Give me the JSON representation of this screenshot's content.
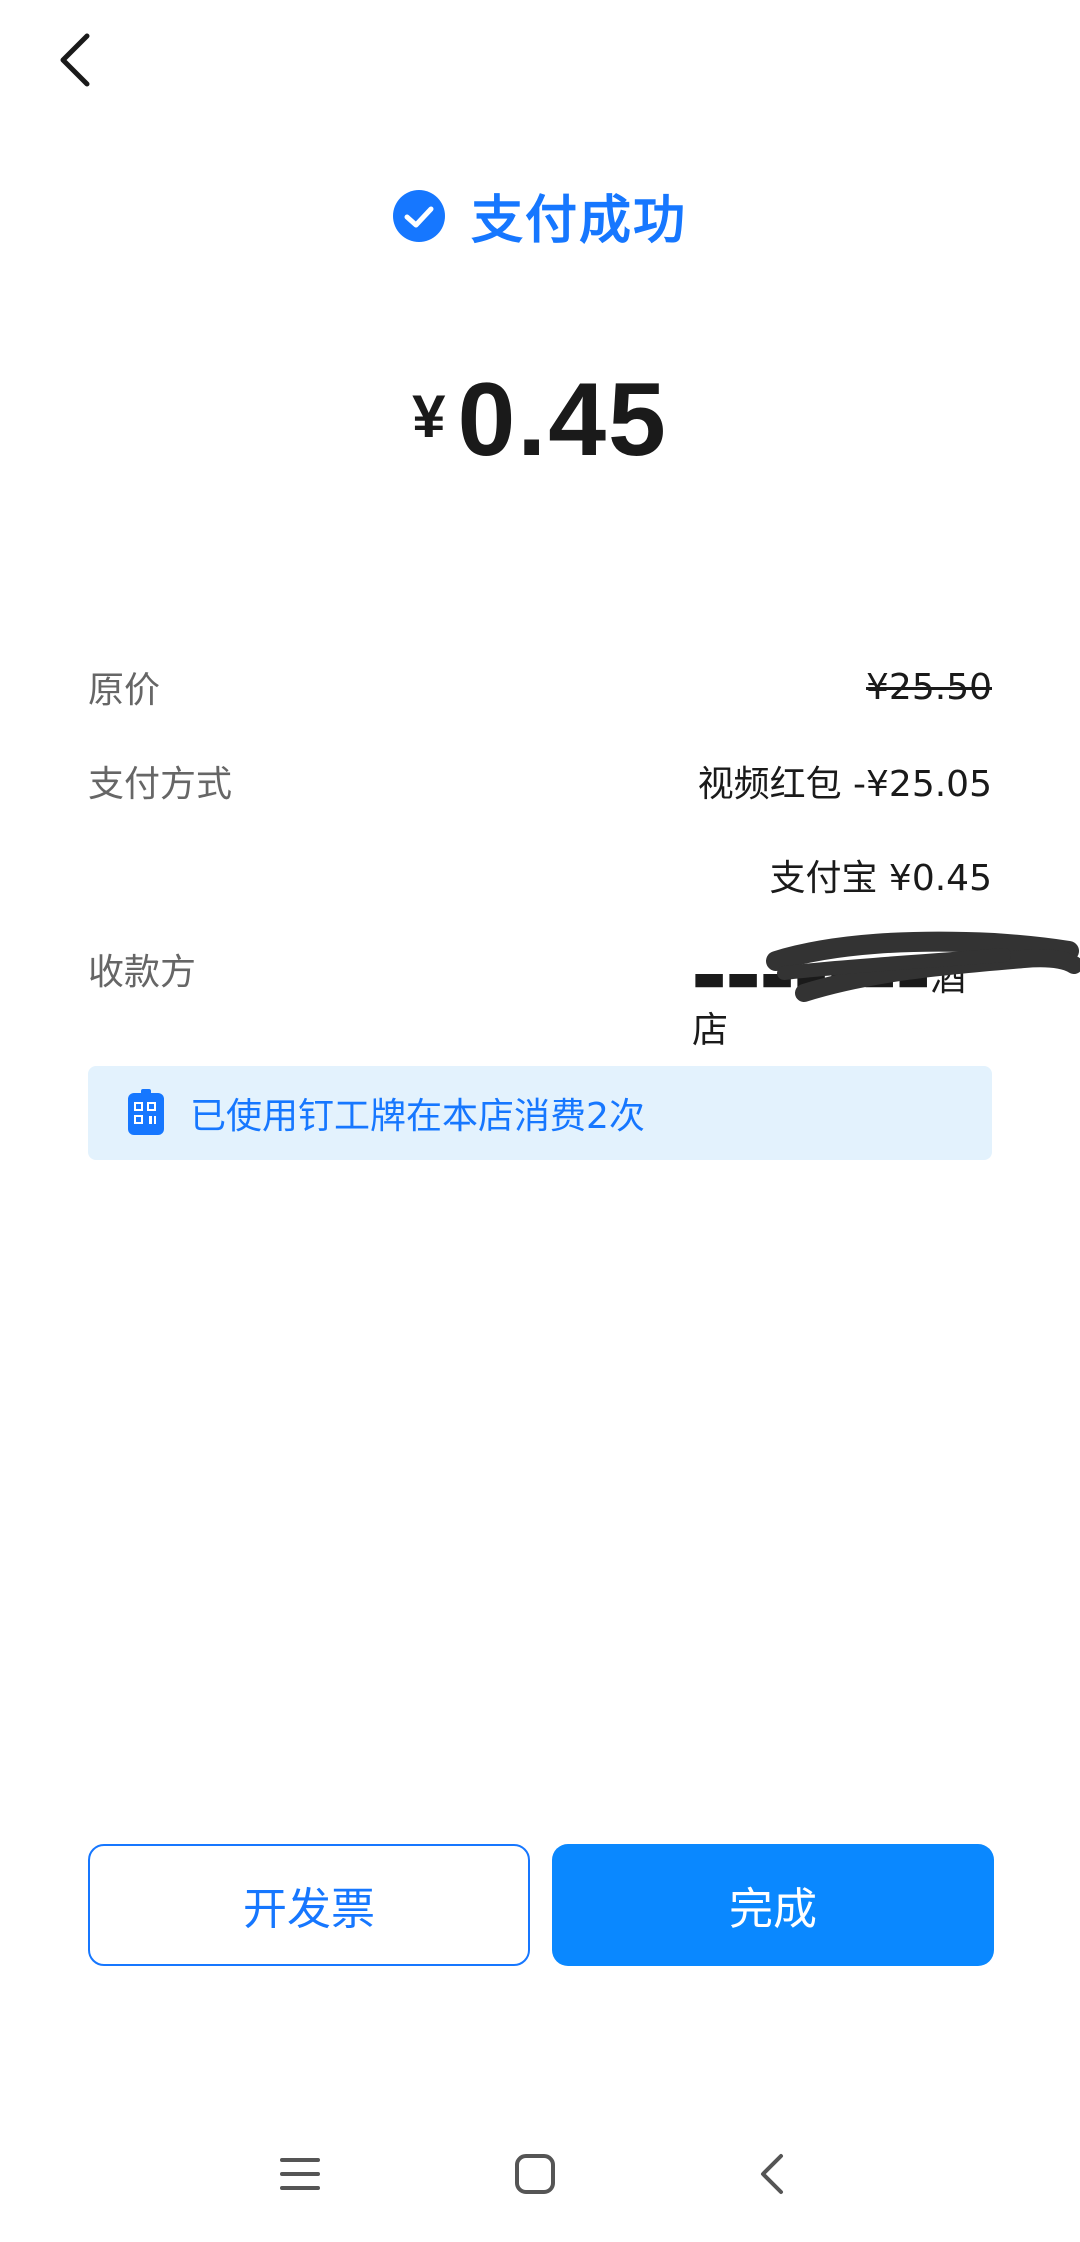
{
  "header": {
    "back_icon": "chevron-left-icon"
  },
  "status": {
    "icon": "check-circle-icon",
    "title": "支付成功",
    "color": "#1677ff"
  },
  "amount": {
    "currency": "¥",
    "value": "0.45"
  },
  "details": {
    "original_price_label": "原价",
    "original_price_value": "¥25.50",
    "payment_method_label": "支付方式",
    "payment_discount": "视频红包 -¥25.05",
    "payment_alipay": "支付宝 ¥0.45",
    "payee_label": "收款方",
    "payee_value": "▬▬▬▬▬▬▬酒店",
    "discount_color": "#e0a21b"
  },
  "banner": {
    "icon": "badge-card-icon",
    "text": "已使用钉工牌在本店消费2次"
  },
  "buttons": {
    "invoice": "开发票",
    "done": "完成",
    "primary_color": "#0a88ff"
  },
  "navbar": {
    "menu_icon": "menu-icon",
    "home_icon": "home-square-icon",
    "back_icon": "back-arrow-icon"
  }
}
